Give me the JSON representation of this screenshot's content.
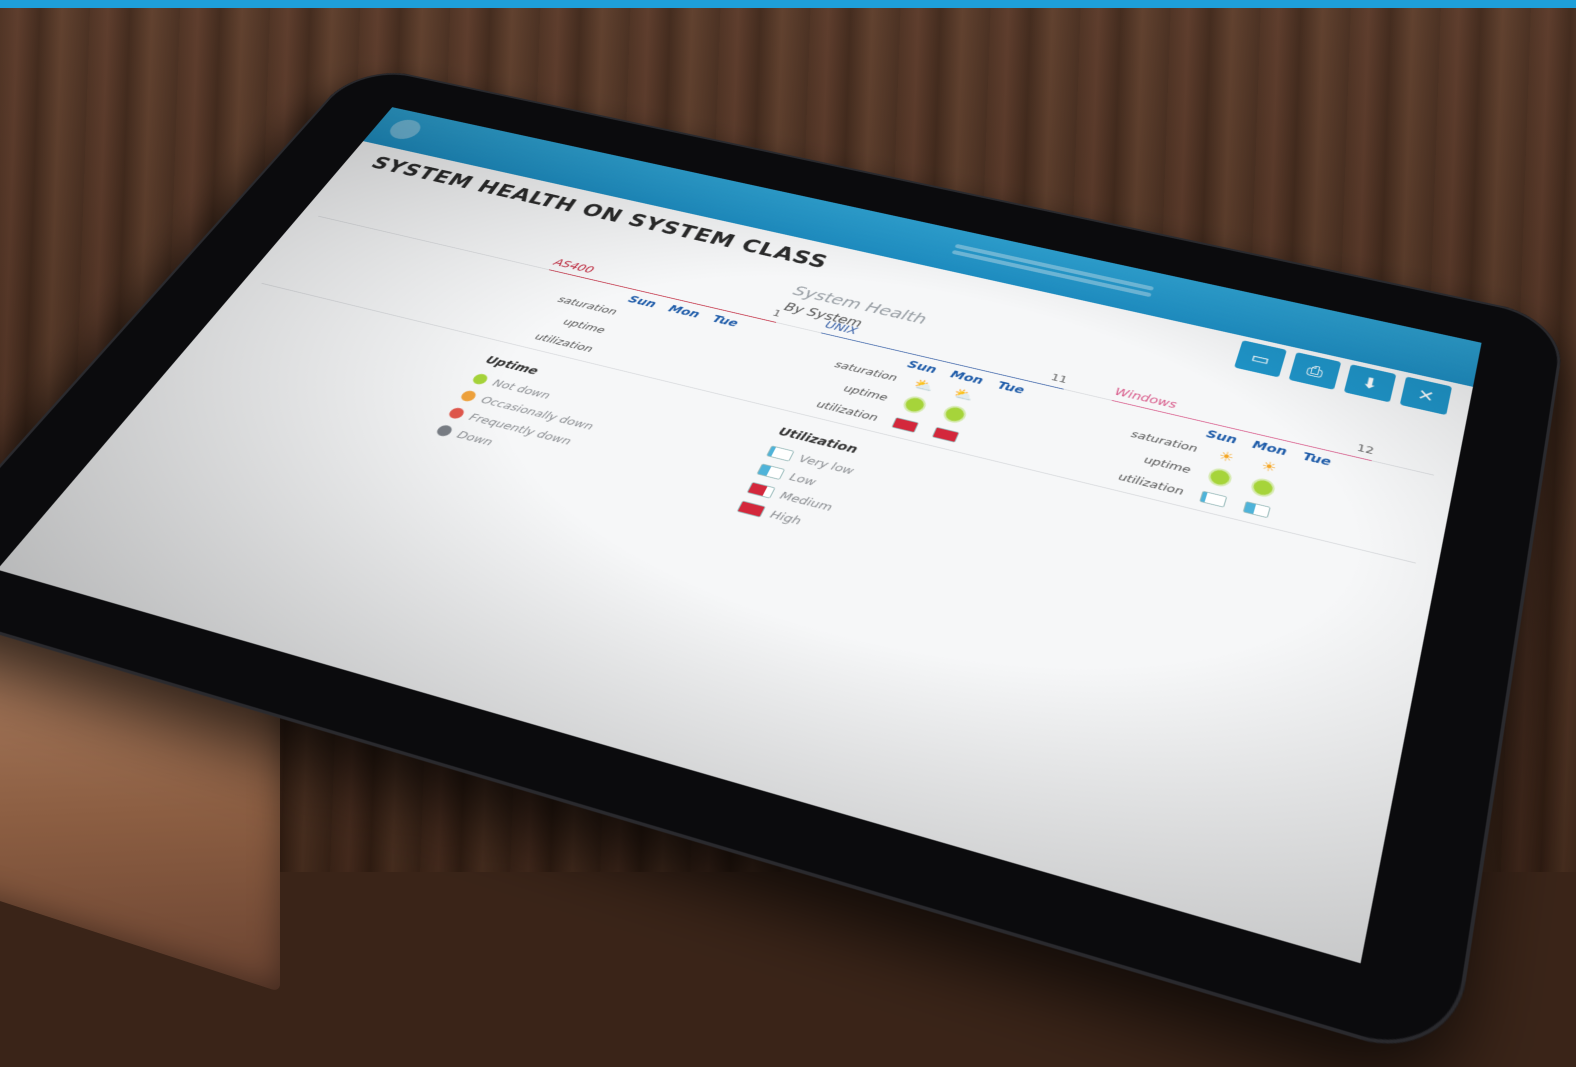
{
  "app": {
    "title": "SYSTEM HEALTH ON SYSTEM CLASS",
    "subtitle": "System Health",
    "view": "By System"
  },
  "toolbar": {
    "buttons": [
      {
        "icon": "monitor-icon",
        "glyph": "▭"
      },
      {
        "icon": "print-icon",
        "glyph": "⎙"
      },
      {
        "icon": "download-icon",
        "glyph": "⬇"
      },
      {
        "icon": "close-icon",
        "glyph": "✕"
      }
    ]
  },
  "panels": [
    {
      "name": "AS400",
      "count": "1",
      "days": [
        "Sun",
        "Mon",
        "Tue"
      ],
      "metrics": [
        {
          "label": "saturation",
          "cells": [
            "",
            "",
            ""
          ]
        },
        {
          "label": "uptime",
          "cells": [
            "",
            "",
            ""
          ]
        },
        {
          "label": "utilization",
          "cells": [
            "",
            "",
            ""
          ]
        }
      ]
    },
    {
      "name": "UNIX",
      "count": "11",
      "days": [
        "Sun",
        "Mon",
        "Tue"
      ],
      "metrics": [
        {
          "label": "saturation",
          "cells": [
            "cloudy",
            "cloudy",
            ""
          ]
        },
        {
          "label": "uptime",
          "cells": [
            "green",
            "green",
            ""
          ]
        },
        {
          "label": "utilization",
          "cells": [
            "high",
            "high",
            ""
          ]
        }
      ]
    },
    {
      "name": "Windows",
      "count": "12",
      "days": [
        "Sun",
        "Mon",
        "Tue"
      ],
      "metrics": [
        {
          "label": "saturation",
          "cells": [
            "sunny",
            "sunny",
            ""
          ]
        },
        {
          "label": "uptime",
          "cells": [
            "green",
            "green",
            ""
          ]
        },
        {
          "label": "utilization",
          "cells": [
            "verylow",
            "low",
            ""
          ]
        }
      ]
    }
  ],
  "uptime_legend": {
    "title": "Uptime",
    "items": [
      {
        "label": "Not down",
        "color": "#a6d43a"
      },
      {
        "label": "Occasionally down",
        "color": "#f0a23c"
      },
      {
        "label": "Frequently down",
        "color": "#e2574c"
      },
      {
        "label": "Down",
        "color": "#7a7f86"
      }
    ]
  },
  "utilization_legend": {
    "title": "Utilization",
    "items": [
      {
        "label": "Very low",
        "level": "verylow"
      },
      {
        "label": "Low",
        "level": "low"
      },
      {
        "label": "Medium",
        "level": "medium"
      },
      {
        "label": "High",
        "level": "high"
      }
    ]
  },
  "colors": {
    "accent": "#1e9fd9",
    "as400": "#c0243a",
    "unix": "#3a62a8",
    "windows": "#d85a8a"
  }
}
